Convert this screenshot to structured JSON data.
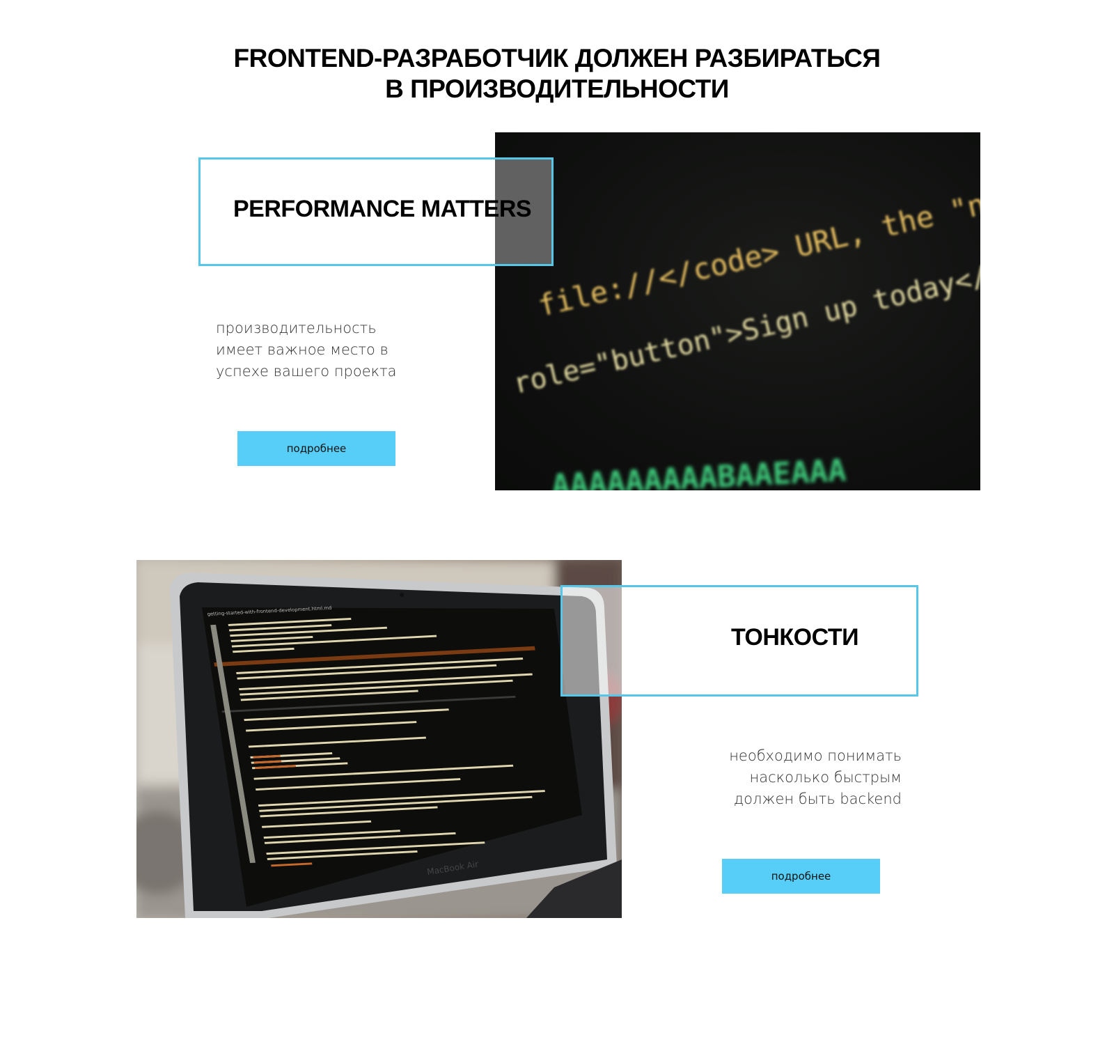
{
  "heading": {
    "line1": "FRONTEND-РАЗРАБОТЧИК ДОЛЖЕН РАЗБИРАТЬСЯ",
    "line2": "В ПРОИЗВОДИТЕЛЬНОСТИ"
  },
  "section1": {
    "title": "PERFORMANCE MATTERS",
    "description": [
      "производительность",
      "имеет важное место в",
      "успехе вашего проекта"
    ],
    "button_label": "подробнее",
    "photo_code_lines": [
      "file://</code> URL, the \"next\"",
      "role=\"button\">Sign up today</a></",
      "AAAAAAAAABAAEAAA"
    ]
  },
  "section2": {
    "title": "ТОНКОСТИ",
    "description": [
      "необходимо понимать",
      "насколько быстрым",
      "должен быть backend"
    ],
    "button_label": "подробнее",
    "laptop_brand": "MacBook Air",
    "editor_tab": "getting-started-with-frontend-development.html.md"
  },
  "colors": {
    "accent_border": "#56c6e9",
    "button_bg": "#56cef7"
  }
}
